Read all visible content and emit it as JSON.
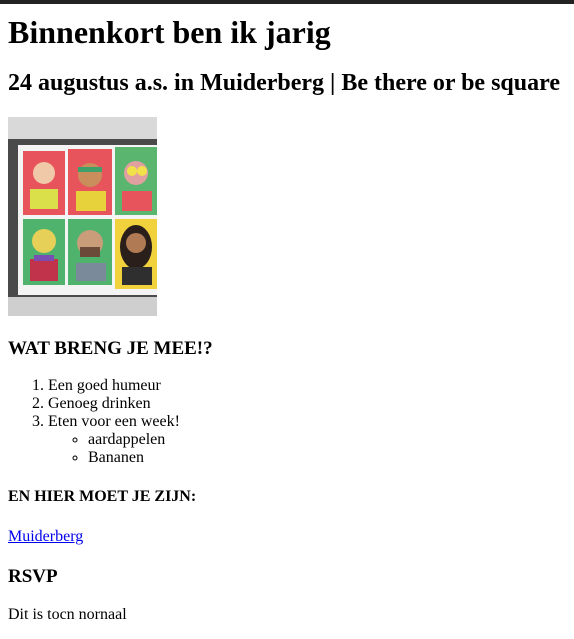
{
  "page": {
    "title": "Binnenkort ben ik jarig",
    "subtitle": "24 augustus a.s. in Muiderberg | Be there or be square"
  },
  "image": {
    "alt": "Portretten",
    "accent_colors": [
      "#e8545c",
      "#4fb36e",
      "#f2d23c",
      "#7a4fb3"
    ]
  },
  "bring": {
    "heading": "WAT BRENG JE MEE!?",
    "items": [
      "Een goed humeur",
      "Genoeg drinken",
      "Eten voor een week!"
    ],
    "subitems": [
      "aardappelen",
      "Bananen"
    ]
  },
  "location": {
    "heading": "EN HIER MOET JE ZIJN:",
    "link_label": "Muiderberg"
  },
  "rsvp": {
    "heading": "RSVP",
    "text": "Dit is tocn nornaal"
  }
}
